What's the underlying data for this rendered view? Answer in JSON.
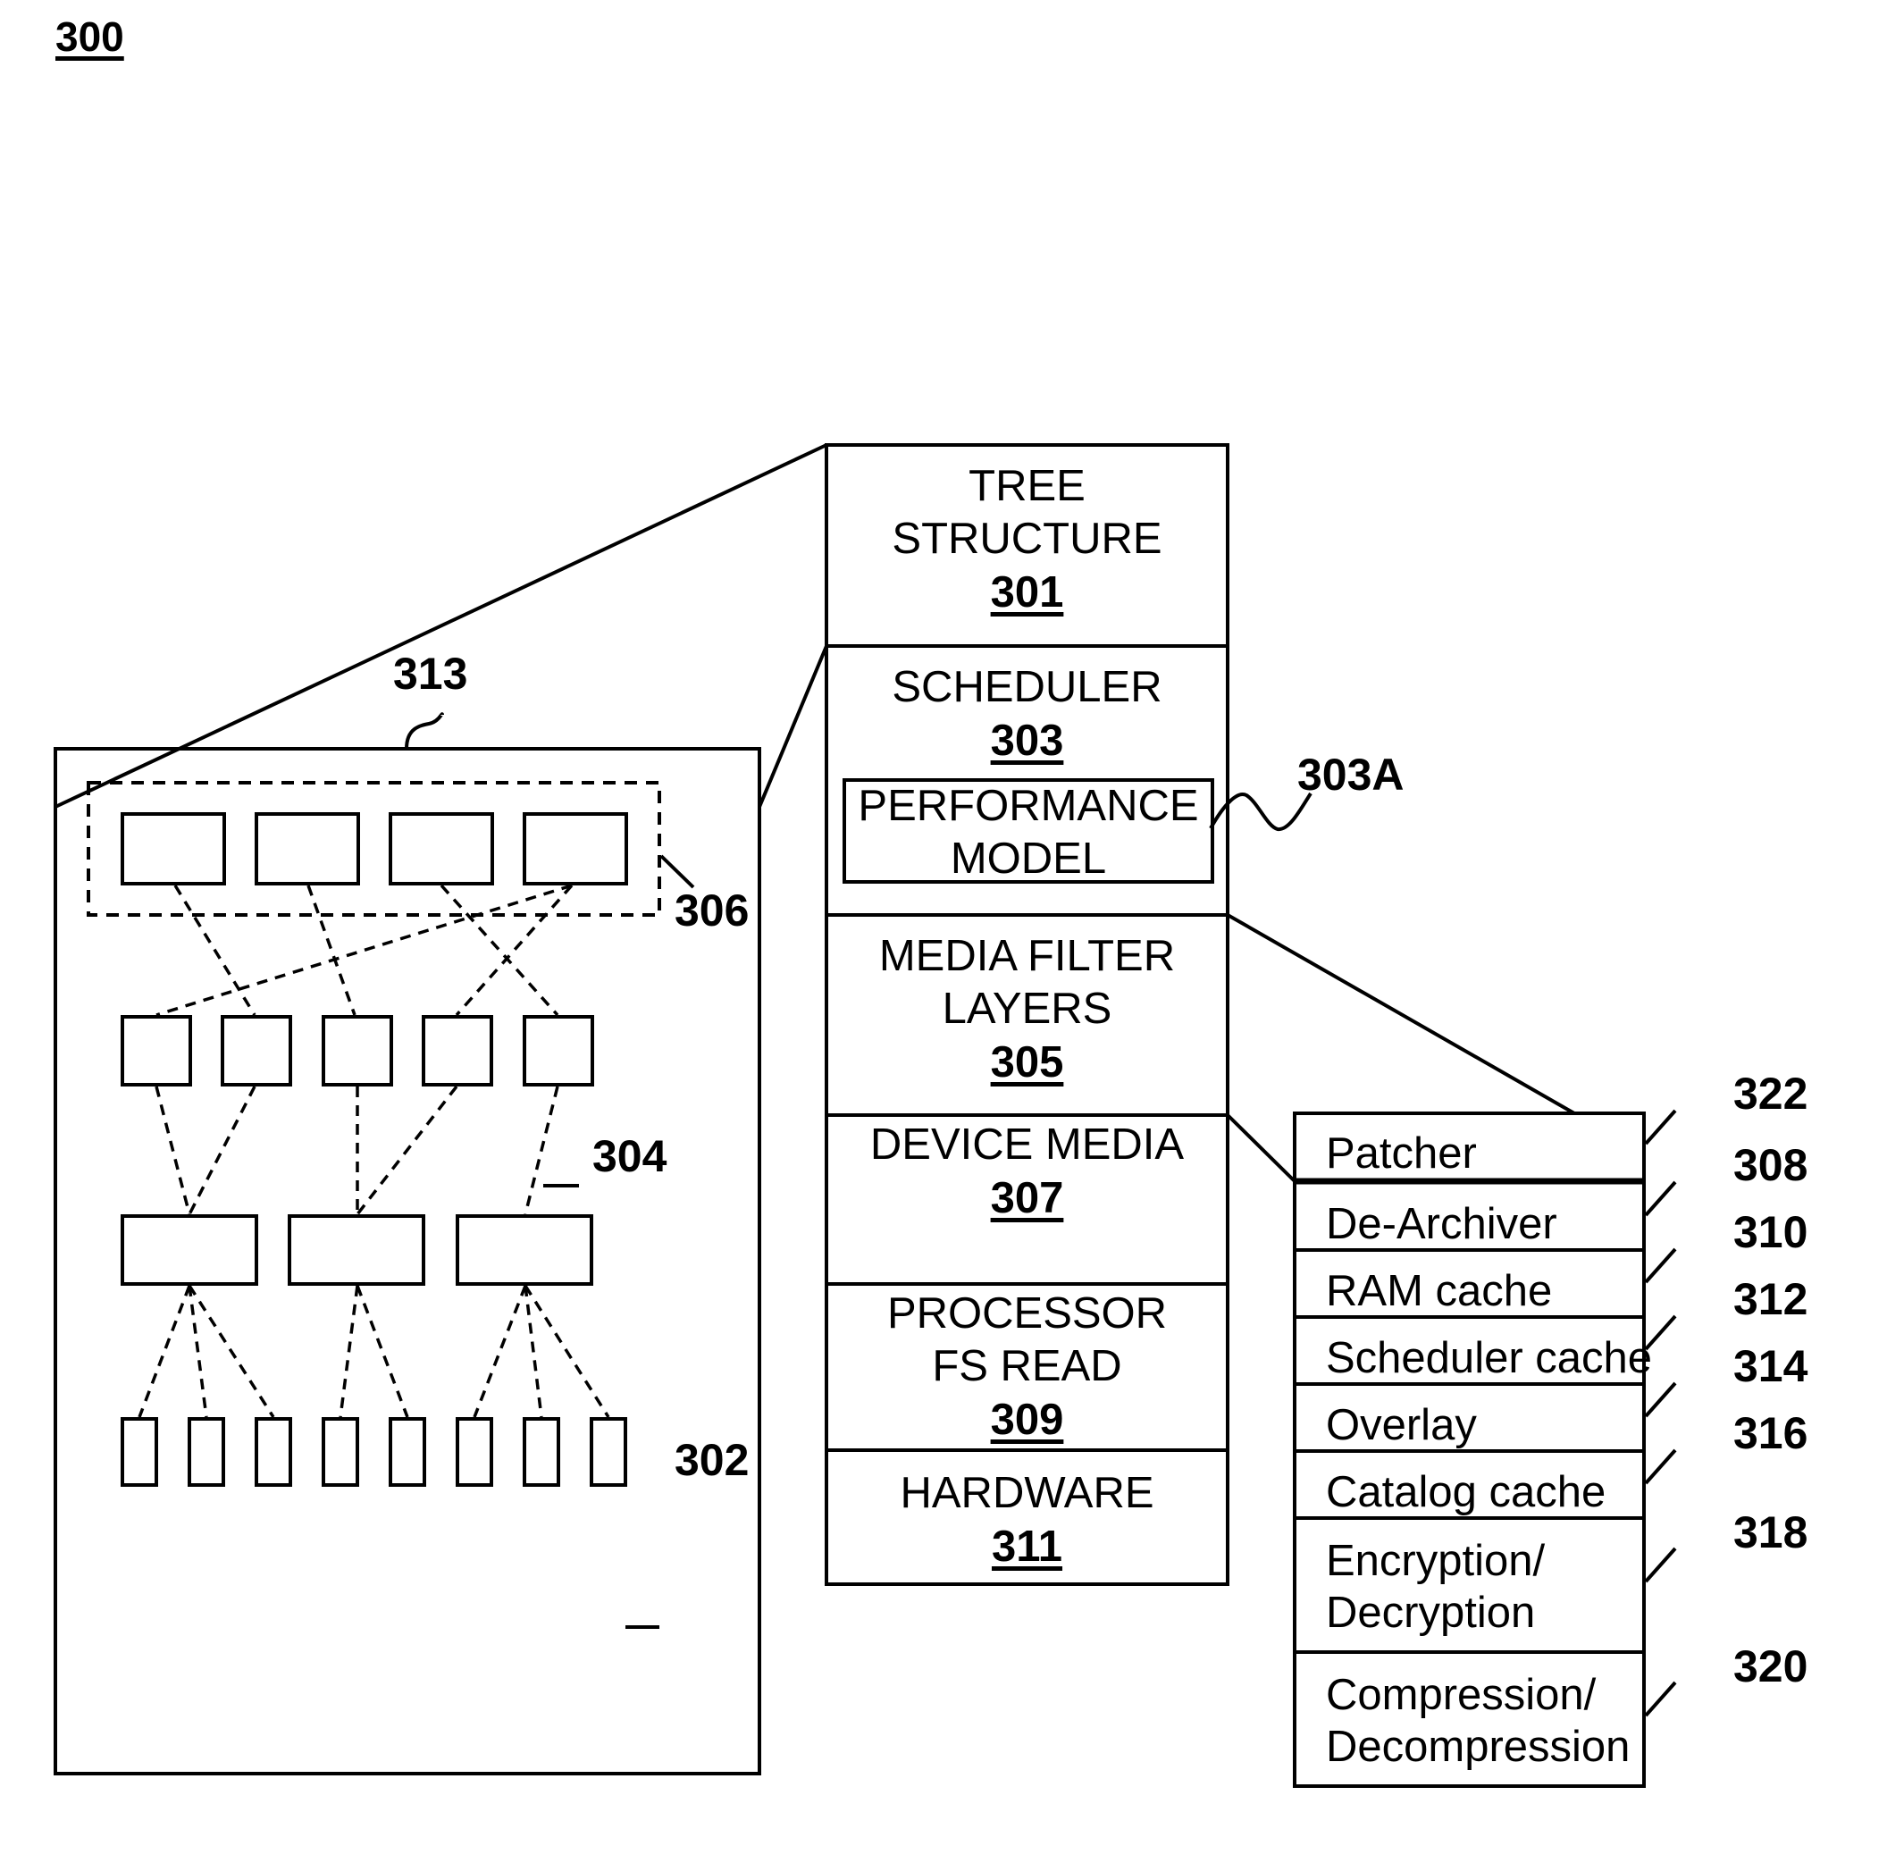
{
  "figure": {
    "number": "300"
  },
  "stack": [
    {
      "lines": [
        "TREE",
        "STRUCTURE"
      ],
      "ref": "301"
    },
    {
      "lines": [
        "SCHEDULER"
      ],
      "ref": "303"
    },
    {
      "lines": [
        "MEDIA FILTER",
        "LAYERS"
      ],
      "ref": "305"
    },
    {
      "lines": [
        "DEVICE MEDIA"
      ],
      "ref": "307"
    },
    {
      "lines": [
        "PROCESSOR",
        "FS READ"
      ],
      "ref": "309"
    },
    {
      "lines": [
        "HARDWARE"
      ],
      "ref": "311"
    }
  ],
  "performance_model": {
    "lines": [
      "PERFORMANCE",
      "MODEL"
    ],
    "ref": "303A"
  },
  "filter_layers": [
    {
      "lines": [
        "Patcher"
      ],
      "ref": "322"
    },
    {
      "lines": [
        "De-Archiver"
      ],
      "ref": "308"
    },
    {
      "lines": [
        "RAM cache"
      ],
      "ref": "310"
    },
    {
      "lines": [
        "Scheduler cache"
      ],
      "ref": "312"
    },
    {
      "lines": [
        "Overlay"
      ],
      "ref": "314"
    },
    {
      "lines": [
        "Catalog cache"
      ],
      "ref": "316"
    },
    {
      "lines": [
        "Encryption/",
        "Decryption"
      ],
      "ref": "318"
    },
    {
      "lines": [
        "Compression/",
        "Decompression"
      ],
      "ref": "320"
    }
  ],
  "tree": {
    "panel_ref": "313",
    "root_group_ref": "306",
    "nodes_ref": "304",
    "leaves_ref": "302"
  }
}
